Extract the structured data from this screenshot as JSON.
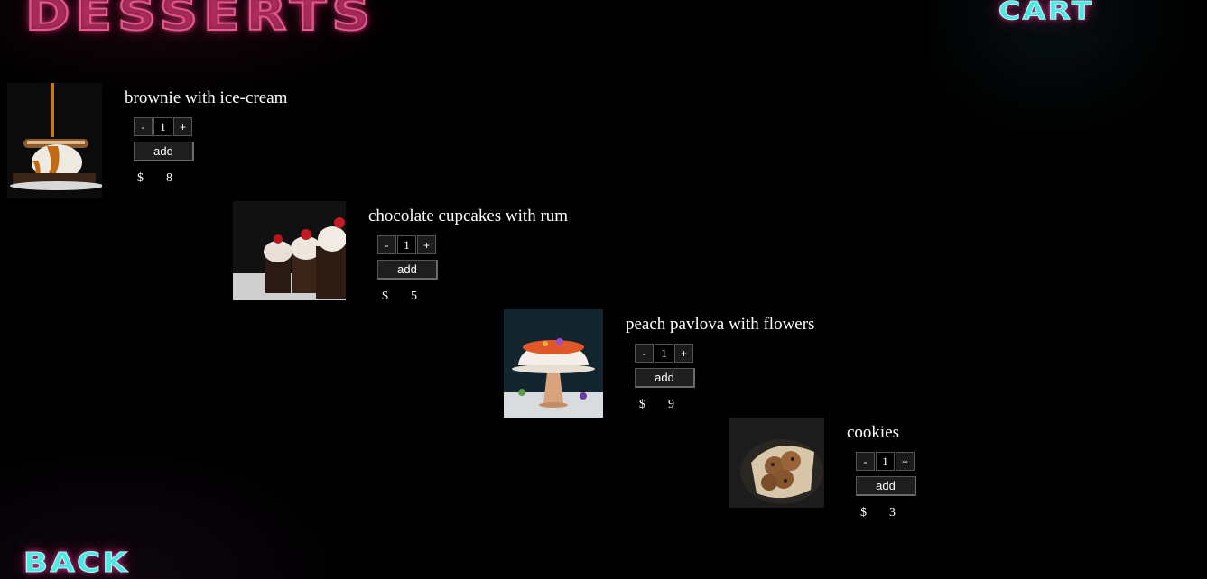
{
  "header": {
    "title": "DESSERTS",
    "cart_label": "CART"
  },
  "footer": {
    "back_label": "BACK"
  },
  "colors": {
    "background": "#000000",
    "title_neon": "#e05a8f",
    "cart_neon": "#53e6e0"
  },
  "products": [
    {
      "name": "brownie with ice-cream",
      "quantity": "1",
      "minus": "-",
      "plus": "+",
      "add_label": "add",
      "currency": "$",
      "price": "8"
    },
    {
      "name": "chocolate cupcakes with rum",
      "quantity": "1",
      "minus": "-",
      "plus": "+",
      "add_label": "add",
      "currency": "$",
      "price": "5"
    },
    {
      "name": "peach pavlova with flowers",
      "quantity": "1",
      "minus": "-",
      "plus": "+",
      "add_label": "add",
      "currency": "$",
      "price": "9"
    },
    {
      "name": "cookies",
      "quantity": "1",
      "minus": "-",
      "plus": "+",
      "add_label": "add",
      "currency": "$",
      "price": "3"
    }
  ]
}
